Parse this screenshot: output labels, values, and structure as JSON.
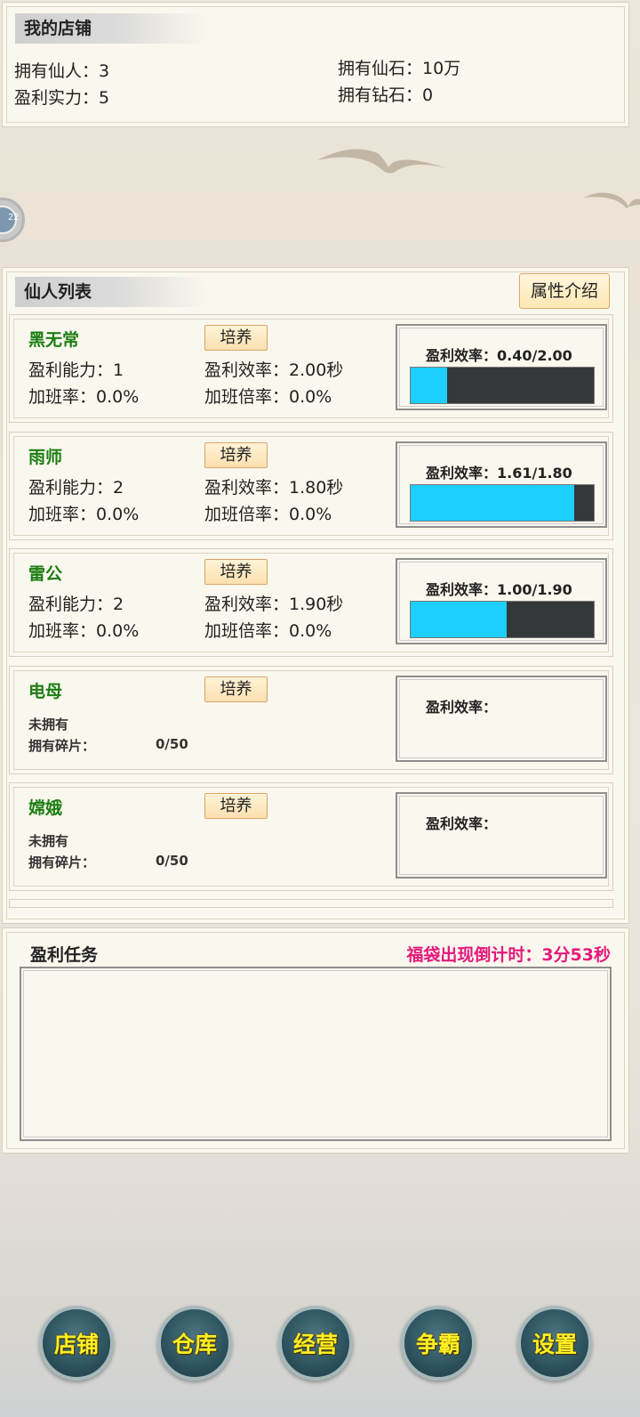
{
  "shop": {
    "title": "我的店铺",
    "immortals_label": "拥有仙人：",
    "immortals_value": "3",
    "stones_label": "拥有仙石：",
    "stones_value": "10万",
    "power_label": "盈利实力：",
    "power_value": "5",
    "diamonds_label": "拥有钻石：",
    "diamonds_value": "0"
  },
  "badge": {
    "text": "22"
  },
  "list": {
    "title": "仙人列表",
    "attr_button": "属性介绍",
    "train_label": "培养",
    "rate_label": "盈利效率：",
    "cards": [
      {
        "name": "黑无常",
        "ability": "盈利能力：1",
        "efficiency": "盈利效率：2.00秒",
        "overtime_rate": "加班率：0.0%",
        "overtime_mult": "加班倍率：0.0%",
        "bar_text": "盈利效率：0.40/2.00",
        "progress": 0.2
      },
      {
        "name": "雨师",
        "ability": "盈利能力：2",
        "efficiency": "盈利效率：1.80秒",
        "overtime_rate": "加班率：0.0%",
        "overtime_mult": "加班倍率：0.0%",
        "bar_text": "盈利效率：1.61/1.80",
        "progress": 0.894
      },
      {
        "name": "雷公",
        "ability": "盈利能力：2",
        "efficiency": "盈利效率：1.90秒",
        "overtime_rate": "加班率：0.0%",
        "overtime_mult": "加班倍率：0.0%",
        "bar_text": "盈利效率：1.00/1.90",
        "progress": 0.526
      },
      {
        "name": "电母",
        "status": "未拥有",
        "fragments_label": "拥有碎片：",
        "fragments_value": "0/50",
        "bar_text": "盈利效率："
      },
      {
        "name": "嫦娥",
        "status": "未拥有",
        "fragments_label": "拥有碎片：",
        "fragments_value": "0/50",
        "bar_text": "盈利效率："
      }
    ]
  },
  "tasks": {
    "title": "盈利任务",
    "countdown": "福袋出现倒计时：3分53秒"
  },
  "nav": [
    "店铺",
    "仓库",
    "经营",
    "争霸",
    "设置"
  ],
  "colors": {
    "accent_name": "#1c7d12",
    "progress_fill": "#1ccfff",
    "countdown": "#e5197a",
    "nav_text": "#ffef23"
  }
}
